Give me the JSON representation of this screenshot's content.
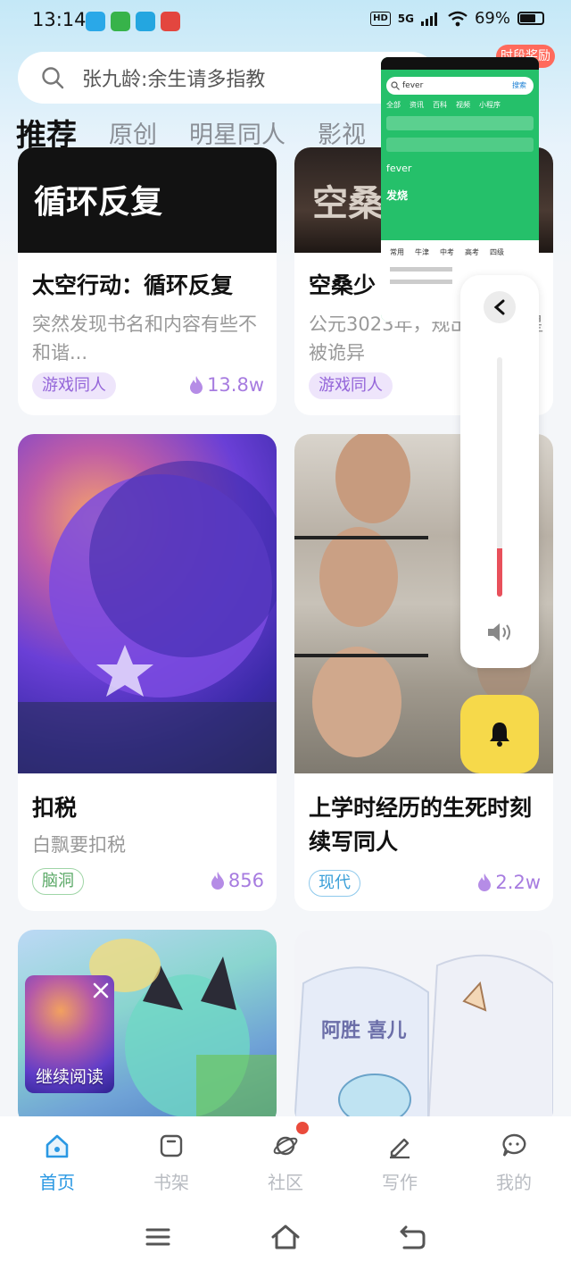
{
  "status_bar": {
    "time": "13:14",
    "network_label": "HD",
    "signal_label": "5G",
    "battery": "69%"
  },
  "search": {
    "placeholder": "张九龄:余生请多指教"
  },
  "reward_badge": "时段奖励",
  "tabs": [
    "推荐",
    "原创",
    "明星同人",
    "影视"
  ],
  "cards": [
    {
      "title": "太空行动：循环反复",
      "desc": "突然发现书名和内容有些不和谐...",
      "tag": "游戏同人",
      "heat": "13.8w",
      "cover_text": "循环反复"
    },
    {
      "title": "空桑少",
      "desc": "公元3023年，规出现，蓝星被诡异",
      "tag": "游戏同人",
      "heat": "",
      "cover_text": "空桑"
    },
    {
      "title": "扣税",
      "desc": "白飘要扣税",
      "tag": "脑洞",
      "heat": "856",
      "cover_text": ""
    },
    {
      "title": "上学时经历的生死时刻续写同人",
      "desc": "",
      "tag": "现代",
      "heat": "2.2w",
      "cover_text": ""
    },
    {
      "title": "",
      "desc": "",
      "tag": "",
      "heat": "",
      "cover_text": ""
    },
    {
      "title": "",
      "desc": "",
      "tag": "",
      "heat": "",
      "cover_text": "阿胜 喜儿"
    }
  ],
  "overlay": {
    "search_value": "fever",
    "search_button": "搜索",
    "tabs": [
      "全部",
      "资讯",
      "百科",
      "视频",
      "小程序"
    ],
    "word": "fever",
    "meaning": "发烧",
    "dict_tabs": [
      "常用",
      "牛津",
      "中考",
      "高考",
      "四级"
    ]
  },
  "volume": {
    "level_percent": 20
  },
  "continue_reading": {
    "label": "继续阅读"
  },
  "nav": [
    {
      "label": "首页",
      "icon": "home-icon",
      "active": true
    },
    {
      "label": "书架",
      "icon": "bookshelf-icon",
      "active": false
    },
    {
      "label": "社区",
      "icon": "planet-icon",
      "active": false
    },
    {
      "label": "写作",
      "icon": "pen-icon",
      "active": false
    },
    {
      "label": "我的",
      "icon": "chat-bubble-icon",
      "active": false
    }
  ],
  "colors": {
    "accent": "#2a98e3",
    "tag_purple": "#9465d9",
    "volume_red": "#e8505b",
    "bell_yellow": "#f6d94a"
  }
}
